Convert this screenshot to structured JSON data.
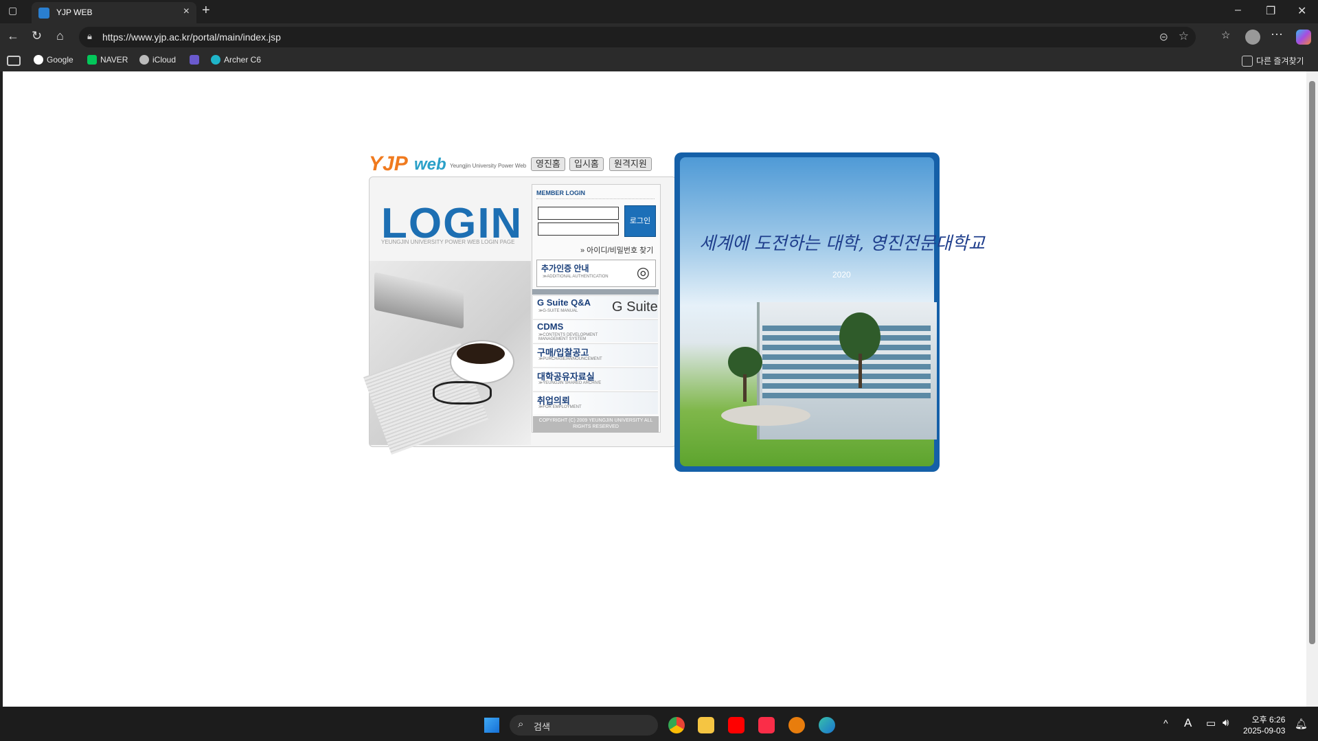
{
  "browser": {
    "tab_title": "YJP WEB",
    "url": "https://www.yjp.ac.kr/portal/main/index.jsp",
    "bookmarks": [
      "Google",
      "NAVER",
      "iCloud",
      "Archer C6"
    ],
    "other_bookmarks": "다른 즐겨찾기"
  },
  "header": {
    "logo_yjp": "YJP",
    "logo_web": "web",
    "logo_sub": "Yeungjin University Power Web",
    "links": [
      "영진홈",
      "입시홈",
      "원격지원"
    ]
  },
  "login": {
    "title": "LOGIN",
    "subtitle": "YEUNGJIN UNIVERSITY POWER WEB LOGIN PAGE",
    "member_title": "MEMBER LOGIN",
    "button": "로그인",
    "find_link": "» 아이디/비밀번호 찾기",
    "auth_title": "추가인증 안내",
    "auth_sub": "≫ADDITIONAL AUTHENTICATION",
    "copyright": "COPYRIGHT (C) 2009 YEUNGJIN UNIVERSITY ALL RIGHTS RESERVED"
  },
  "menu": [
    {
      "title": "G Suite Q&A",
      "sub": "≫G-SUITE MANUAL"
    },
    {
      "title": "CDMS",
      "sub": "≫CONTENTS DEVELOPMENT MANAGEMENT SYSTEM"
    },
    {
      "title": "구매/입찰공고",
      "sub": "≫PURCHASE/ANNOUNCEMENT"
    },
    {
      "title": "대학공유자료실",
      "sub": "≫YEUNGJIN SHARED ARCHIVE"
    },
    {
      "title": "취업의뢰",
      "sub": "≫FOR EMPLOYMENT"
    }
  ],
  "gsuite_brand": "G Suite",
  "campus": {
    "slogan": "세계에 도전하는 대학, 영진전문대학교",
    "sub": "2020"
  },
  "taskbar": {
    "search_placeholder": "검색",
    "time": "오후 6:26",
    "date": "2025-09-03"
  }
}
